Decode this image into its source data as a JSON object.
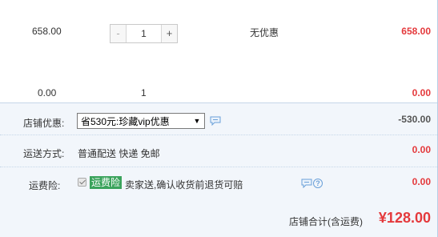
{
  "item": {
    "unit_price": "658.00",
    "quantity": "1",
    "minus_label": "-",
    "plus_label": "+",
    "promotion": "无优惠",
    "subtotal": "658.00"
  },
  "item2": {
    "unit_price": "0.00",
    "quantity": "1",
    "subtotal": "0.00"
  },
  "summary": {
    "shop_discount_label": "店铺优惠:",
    "shop_discount_selected": "省530元:珍藏vip优惠",
    "shop_discount_amount": "-530.00",
    "shipping_label": "运送方式:",
    "shipping_method": "普通配送 快递 免邮",
    "shipping_amount": "0.00",
    "insurance_label": "运费险:",
    "insurance_tag": "运费险",
    "insurance_desc": "卖家送,确认收货前退货可赔",
    "insurance_amount": "0.00",
    "total_label": "店铺合计(含运费)",
    "total_value": "¥128.00"
  },
  "colors": {
    "price_red": "#e4393c",
    "summary_bg": "#f2f6fb",
    "insurance_green": "#3aa35c"
  },
  "icons": {
    "chat": "chat-bubble-icon",
    "help": "question-circle-icon"
  }
}
